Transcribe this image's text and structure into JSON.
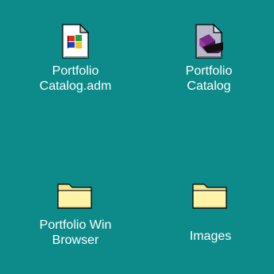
{
  "desktop": {
    "background_color": "#0d8a8a",
    "icons": [
      {
        "kind": "document-icon",
        "label_lines": [
          "Portfolio",
          "Catalog.adm"
        ]
      },
      {
        "kind": "application-icon",
        "label_lines": [
          "Portfolio",
          "Catalog"
        ]
      },
      {
        "kind": "folder-icon",
        "label_lines": [
          "Portfolio Win",
          "Browser"
        ]
      },
      {
        "kind": "folder-icon",
        "label_lines": [
          "Images"
        ]
      }
    ]
  }
}
